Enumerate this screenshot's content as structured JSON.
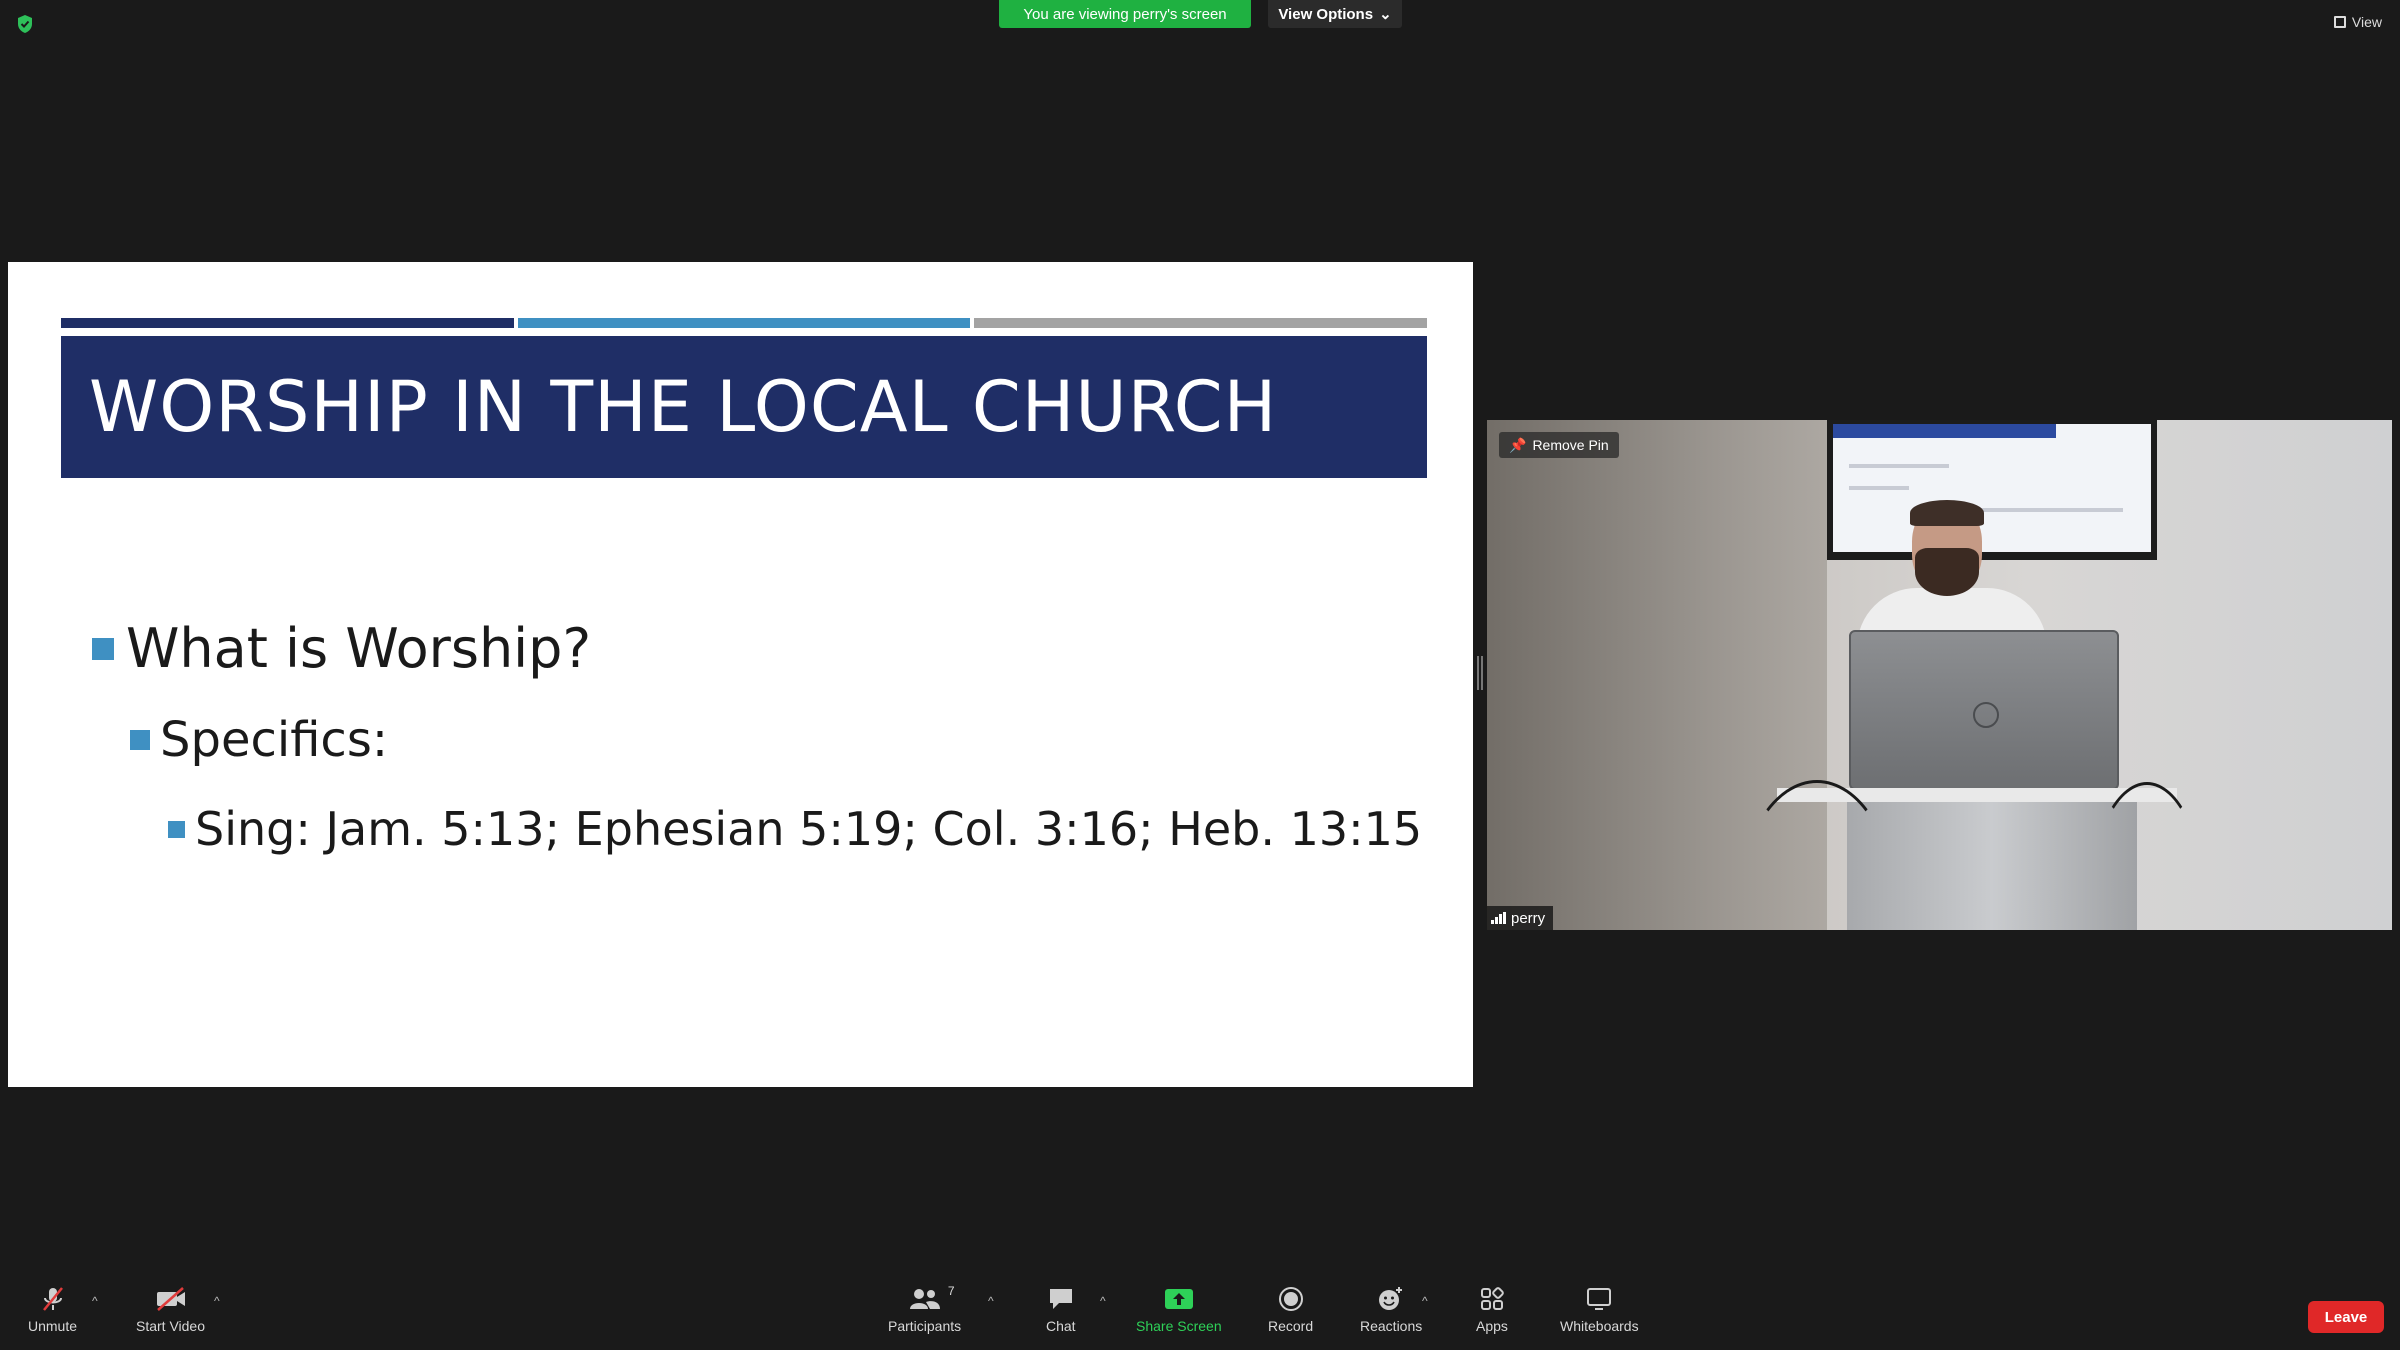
{
  "top": {
    "banner": "You are viewing perry's screen",
    "view_options": "View Options",
    "view": "View"
  },
  "slide": {
    "title": "WORSHIP IN THE LOCAL CHURCH",
    "bullet_1": "What is Worship?",
    "bullet_2": "Specifics:",
    "bullet_3": "Sing: Jam. 5:13; Ephesian 5:19; Col. 3:16; Heb. 13:15"
  },
  "video": {
    "remove_pin": "Remove Pin",
    "participant_name": "perry"
  },
  "toolbar": {
    "unmute": "Unmute",
    "start_video": "Start Video",
    "participants": "Participants",
    "participants_count": "7",
    "chat": "Chat",
    "share_screen": "Share Screen",
    "record": "Record",
    "reactions": "Reactions",
    "apps": "Apps",
    "whiteboards": "Whiteboards",
    "leave": "Leave"
  },
  "colors": {
    "slide_navy": "#1f2e66",
    "slide_blue": "#3f90c2",
    "share_green": "#2ed158",
    "banner_green": "#1fb141",
    "leave_red": "#e02828"
  }
}
